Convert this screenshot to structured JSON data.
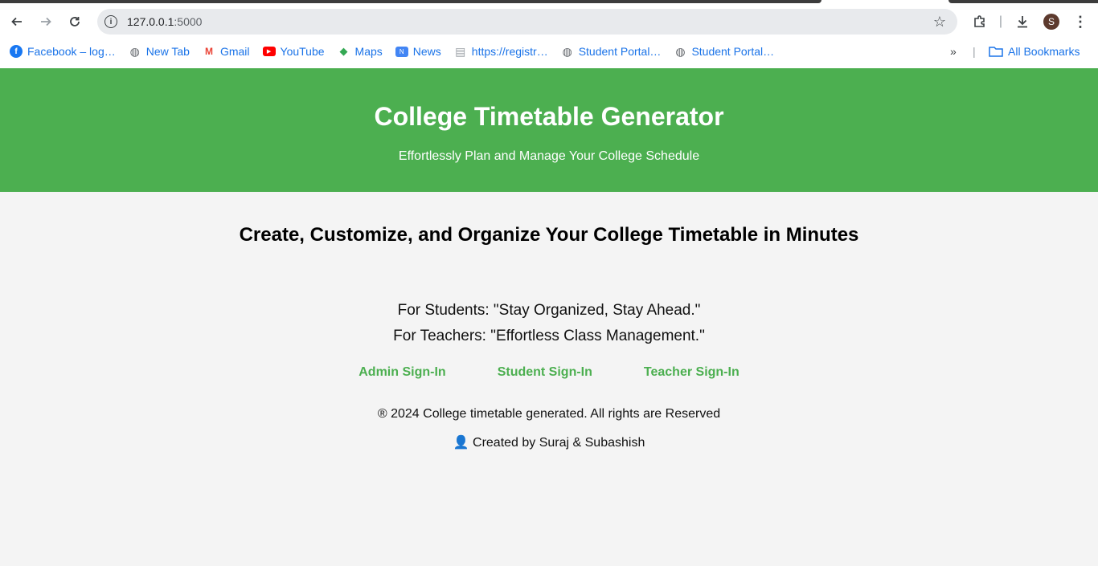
{
  "browser": {
    "url_host": "127.0.0.1",
    "url_port": ":5000",
    "avatar_initial": "S",
    "bookmarks": [
      {
        "label": "Facebook – log…",
        "icon": "facebook-icon",
        "color": "#1877f2"
      },
      {
        "label": "New Tab",
        "icon": "globe-icon",
        "color": "#5f6368"
      },
      {
        "label": "Gmail",
        "icon": "gmail-icon",
        "color": "#ea4335"
      },
      {
        "label": "YouTube",
        "icon": "youtube-icon",
        "color": "#ff0000"
      },
      {
        "label": "Maps",
        "icon": "maps-icon",
        "color": "#34a853"
      },
      {
        "label": "News",
        "icon": "news-icon",
        "color": "#4285f4"
      },
      {
        "label": "https://registr…",
        "icon": "document-icon",
        "color": "#9aa0a6"
      },
      {
        "label": "Student Portal…",
        "icon": "globe-icon",
        "color": "#5f6368"
      },
      {
        "label": "Student Portal…",
        "icon": "globe-icon",
        "color": "#5f6368"
      }
    ],
    "more_bookmarks": "»",
    "all_bookmarks": "All Bookmarks"
  },
  "header": {
    "title": "College Timetable Generator",
    "subtitle": "Effortlessly Plan and Manage Your College Schedule",
    "bg_color": "#4caf50"
  },
  "main": {
    "heading": "Create, Customize, and Organize Your College Timetable in Minutes",
    "students_tagline": "For Students: \"Stay Organized, Stay Ahead.\"",
    "teachers_tagline": "For Teachers: \"Effortless Class Management.\"",
    "links": {
      "admin": "Admin Sign-In",
      "student": "Student Sign-In",
      "teacher": "Teacher Sign-In"
    },
    "copyright": "® 2024 College timetable generated. All rights are Reserved",
    "credit": "👤 Created by Suraj & Subashish"
  }
}
